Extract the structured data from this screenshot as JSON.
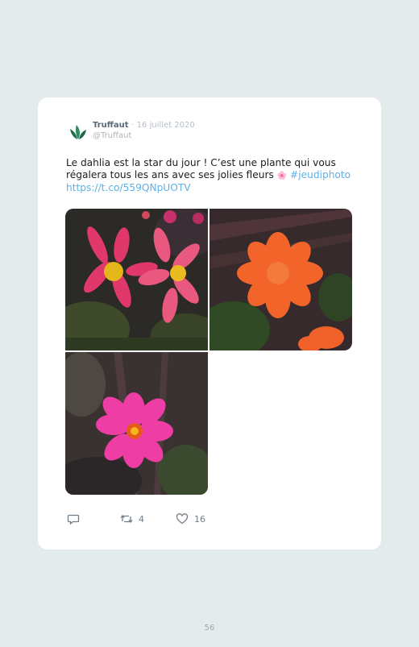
{
  "tweet": {
    "author": "Truffaut",
    "separator": "·",
    "date": "16 juillet 2020",
    "handle": "@Truffaut",
    "text_part1": "Le dahlia est la star du jour ! C’est une plante qui vous régalera tous les ans avec ses jolies fleurs ",
    "emoji": "🌸",
    "hashtag": "#jeudiphoto",
    "link": "https://t.co/559QNpUOTV",
    "photos": [
      {
        "icon": "photo-pink-red-dahlias"
      },
      {
        "icon": "photo-orange-dahlia"
      },
      {
        "icon": "photo-magenta-dahlia"
      }
    ],
    "actions": {
      "reply_icon": "reply-icon",
      "retweet_icon": "retweet-icon",
      "retweet_count": "4",
      "like_icon": "heart-icon",
      "like_count": "16"
    }
  },
  "colors": {
    "background": "#e3ebed",
    "card": "#ffffff",
    "link": "#5fb1e4",
    "brand_green": "#1f6b4e"
  },
  "footer": {
    "page_number": "56"
  }
}
